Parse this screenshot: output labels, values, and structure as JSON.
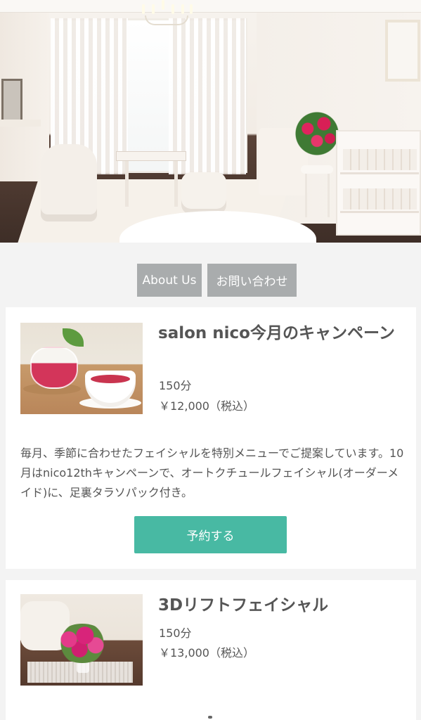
{
  "hero": {
    "image": "salon-interior-photo"
  },
  "nav": {
    "about_label": "About Us",
    "contact_label": "お問い合わせ"
  },
  "menus": [
    {
      "title": "salon nico今月のキャンペーン",
      "duration": "150分",
      "price": "￥12,000（税込）",
      "description": "毎月、季節に合わせたフェイシャルを特別メニューでご提案しています。10月はnico12thキャンペーンで、オートクチュールフェイシャル(オーダーメイド)に、足裏タラソパック付き。",
      "button_label": "予約する",
      "image": "tea-photo"
    },
    {
      "title": "3Dリフトフェイシャル",
      "duration": "150分",
      "price": "￥13,000（税込）",
      "image": "roses-photo"
    }
  ],
  "colors": {
    "page_bg": "#f3f3f3",
    "tab_bg": "#a9acad",
    "button_bg": "#48b9a3",
    "text": "#555555"
  }
}
